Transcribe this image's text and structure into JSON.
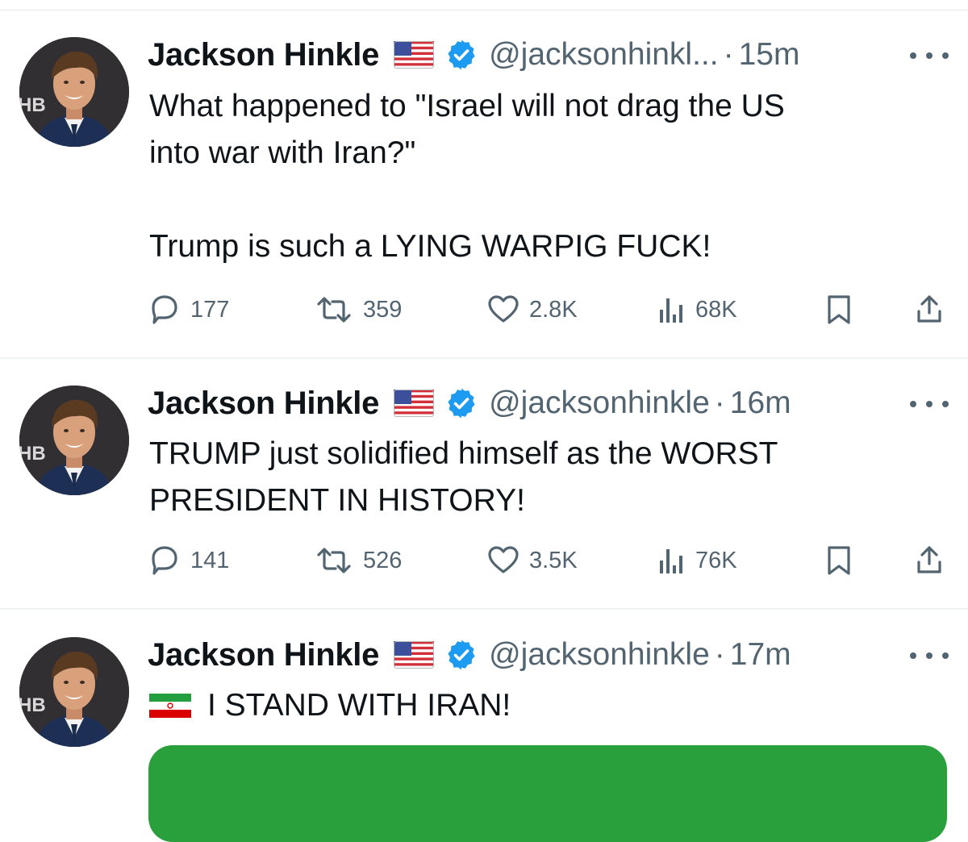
{
  "colors": {
    "verified": "#1d9bf0",
    "muted": "#536471",
    "text": "#0f1419",
    "media_green": "#2aa03c"
  },
  "icons": {
    "reply": "reply-icon",
    "repost": "repost-icon",
    "like": "heart-icon",
    "views": "views-icon",
    "bookmark": "bookmark-icon",
    "share": "share-icon",
    "more": "more-icon",
    "verified": "verified-badge-icon"
  },
  "tweets": [
    {
      "name": "Jackson Hinkle",
      "handle": "@jacksonhinkl...",
      "dot": "·",
      "time": "15m",
      "lines": [
        "What happened to \"Israel will not drag the US",
        "into war with Iran?\"",
        "",
        "Trump is such a LYING WARPIG FUCK!"
      ],
      "stats": {
        "replies": "177",
        "reposts": "359",
        "likes": "2.8K",
        "views": "68K"
      }
    },
    {
      "name": "Jackson Hinkle",
      "handle": "@jacksonhinkle",
      "dot": "·",
      "time": "16m",
      "lines": [
        "TRUMP just solidified himself as the WORST",
        "PRESIDENT IN HISTORY!"
      ],
      "stats": {
        "replies": "141",
        "reposts": "526",
        "likes": "3.5K",
        "views": "76K"
      }
    },
    {
      "name": "Jackson Hinkle",
      "handle": "@jacksonhinkle",
      "dot": "·",
      "time": "17m",
      "lines": [
        "I STAND WITH IRAN!"
      ]
    }
  ]
}
